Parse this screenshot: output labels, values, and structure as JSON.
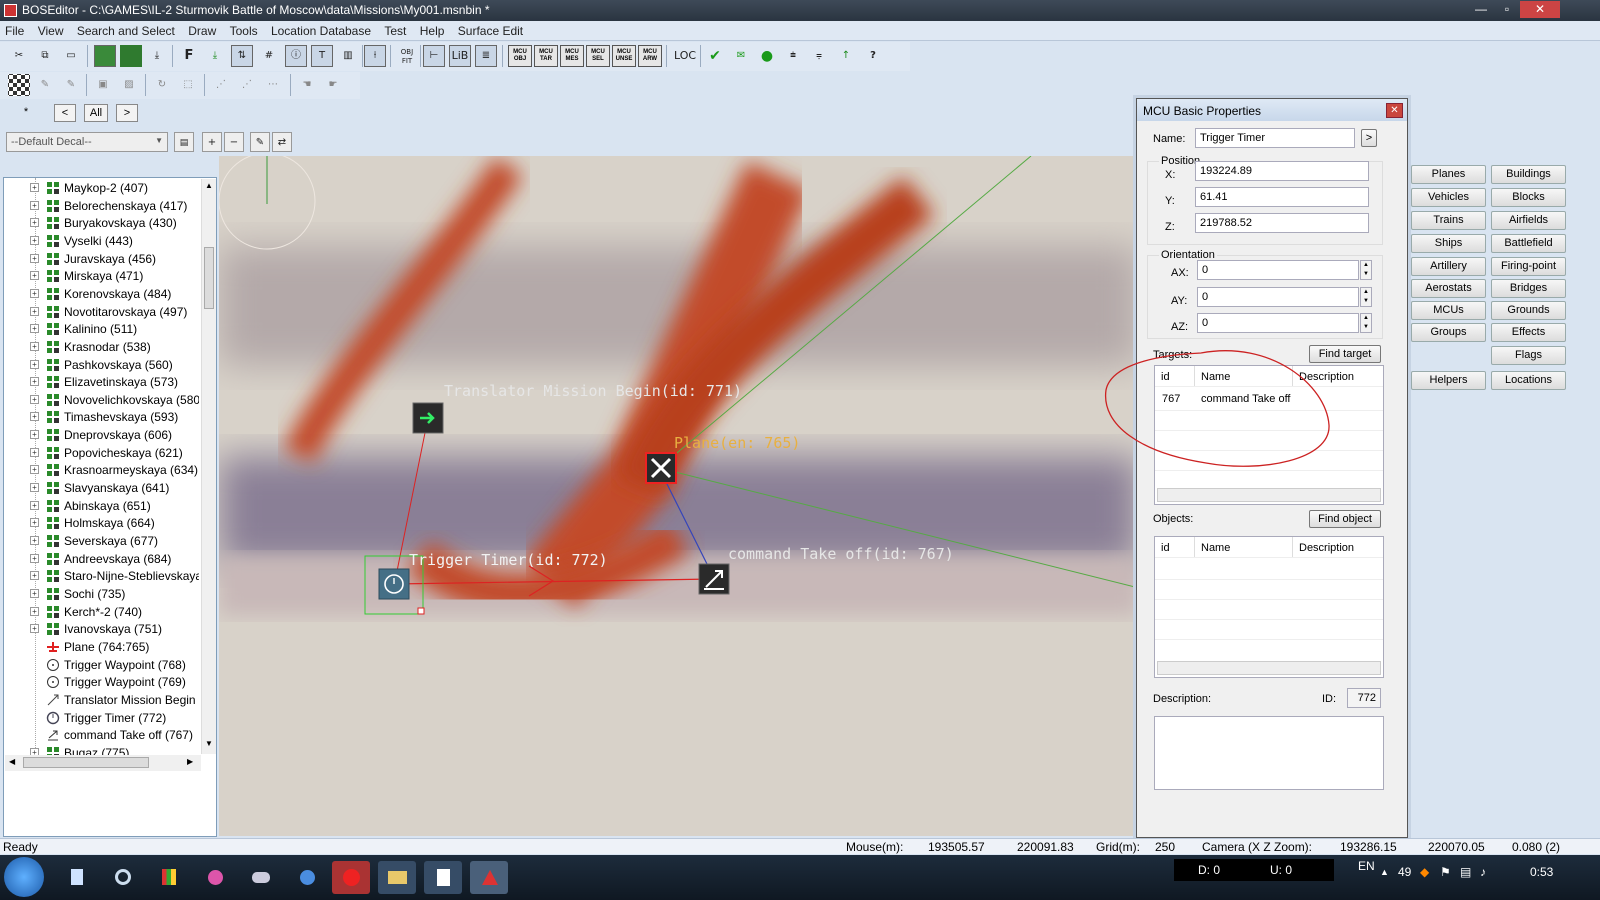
{
  "window": {
    "title": "BOSEditor - C:\\GAMES\\IL-2 Sturmovik Battle of Moscow\\data\\Missions\\My001.msnbin *",
    "min_glyph": "—",
    "max_glyph": "▫",
    "close_glyph": "✕"
  },
  "menu": [
    "File",
    "View",
    "Search and Select",
    "Draw",
    "Tools",
    "Location Database",
    "Test",
    "Help",
    "Surface Edit"
  ],
  "toolbar": {
    "mcu_buttons": [
      "MCU OBJ",
      "MCU TAR",
      "MCU MES",
      "MCU SEL",
      "MCU UNSE",
      "MCU ARW"
    ],
    "loc_label": "LOC",
    "lib_label": "LiB",
    "f_label": "F",
    "obj_fit": "OBJ FIT"
  },
  "selection": {
    "star": "*",
    "prev": "<",
    "all": "All",
    "next": ">"
  },
  "decal": {
    "value": "--Default Decal--"
  },
  "tree": {
    "items": [
      {
        "label": "Maykop-2 (407)",
        "type": "group"
      },
      {
        "label": "Belorechenskaya (417)",
        "type": "group"
      },
      {
        "label": "Buryakovskaya (430)",
        "type": "group"
      },
      {
        "label": "Vyselki (443)",
        "type": "group"
      },
      {
        "label": "Juravskaya (456)",
        "type": "group"
      },
      {
        "label": "Mirskaya (471)",
        "type": "group"
      },
      {
        "label": "Korenovskaya (484)",
        "type": "group"
      },
      {
        "label": "Novotitarovskaya (497)",
        "type": "group"
      },
      {
        "label": "Kalinino (511)",
        "type": "group"
      },
      {
        "label": "Krasnodar (538)",
        "type": "group"
      },
      {
        "label": "Pashkovskaya (560)",
        "type": "group"
      },
      {
        "label": "Elizavetinskaya (573)",
        "type": "group"
      },
      {
        "label": "Novovelichkovskaya (580",
        "type": "group"
      },
      {
        "label": "Timashevskaya (593)",
        "type": "group"
      },
      {
        "label": "Dneprovskaya (606)",
        "type": "group"
      },
      {
        "label": "Popovicheskaya (621)",
        "type": "group"
      },
      {
        "label": "Krasnoarmeyskaya (634)",
        "type": "group"
      },
      {
        "label": "Slavyanskaya (641)",
        "type": "group"
      },
      {
        "label": "Abinskaya (651)",
        "type": "group"
      },
      {
        "label": "Holmskaya (664)",
        "type": "group"
      },
      {
        "label": "Severskaya (677)",
        "type": "group"
      },
      {
        "label": "Andreevskaya (684)",
        "type": "group"
      },
      {
        "label": "Staro-Nijne-Steblievskaya",
        "type": "group"
      },
      {
        "label": "Sochi (735)",
        "type": "group"
      },
      {
        "label": "Kerch*-2 (740)",
        "type": "group"
      },
      {
        "label": "Ivanovskaya (751)",
        "type": "group"
      },
      {
        "label": "Plane (764:765)",
        "type": "plane"
      },
      {
        "label": "Trigger Waypoint (768)",
        "type": "waypoint"
      },
      {
        "label": "Trigger Waypoint (769)",
        "type": "waypoint"
      },
      {
        "label": "Translator Mission Begin",
        "type": "translator"
      },
      {
        "label": "Trigger Timer (772)",
        "type": "timer"
      },
      {
        "label": "command Take off (767)",
        "type": "command"
      },
      {
        "label": "Bugaz (775)",
        "type": "group"
      }
    ]
  },
  "viewport": {
    "labels": {
      "translator": "Translator Mission Begin(id: 771)",
      "plane": "Plane(en: 765)",
      "timer": "Trigger Timer(id: 772)",
      "command": "command Take off(id: 767)"
    },
    "colors": {
      "road": "#c24b2c",
      "selection": "#33cc33",
      "link_red": "#dd2222",
      "link_blue": "#3344bb",
      "link_green": "#55aa44"
    }
  },
  "categories": {
    "left": [
      "Planes",
      "Vehicles",
      "Trains",
      "Ships",
      "Artillery",
      "Aerostats",
      "MCUs",
      "Groups"
    ],
    "right": [
      "Buildings",
      "Blocks",
      "Airfields",
      "Battlefield",
      "Firing-point",
      "Bridges",
      "Grounds",
      "Effects",
      "Flags"
    ],
    "bottom": [
      "Helpers",
      "Locations"
    ]
  },
  "props": {
    "title": "MCU Basic Properties",
    "name_label": "Name:",
    "name_value": "Trigger Timer",
    "name_arrow": ">",
    "position_label": "Position",
    "x_label": "X:",
    "x_value": "193224.89",
    "y_label": "Y:",
    "y_value": "61.41",
    "z_label": "Z:",
    "z_value": "219788.52",
    "orientation_label": "Orientation",
    "ax_label": "AX:",
    "ax_value": "0",
    "ay_label": "AY:",
    "ay_value": "0",
    "az_label": "AZ:",
    "az_value": "0",
    "targets_label": "Targets:",
    "find_target": "Find target",
    "objects_label": "Objects:",
    "find_object": "Find object",
    "col_id": "id",
    "col_name": "Name",
    "col_desc": "Description",
    "targets": [
      {
        "id": "767",
        "name": "command Take off",
        "description": ""
      }
    ],
    "description_label": "Description:",
    "id_label": "ID:",
    "id_value": "772"
  },
  "status": {
    "ready": "Ready",
    "mouse_label": "Mouse(m):",
    "mouse_x": "193505.57",
    "mouse_z": "220091.83",
    "grid_label": "Grid(m):",
    "grid_value": "250",
    "camera_label": "Camera (X Z Zoom):",
    "cam_x": "193286.15",
    "cam_z": "220070.05",
    "cam_zoom": "0.080 (2)"
  },
  "taskbar": {
    "d_label": "D: 0",
    "u_label": "U: 0",
    "lang": "EN",
    "tray_num": "49",
    "clock": "0:53"
  }
}
